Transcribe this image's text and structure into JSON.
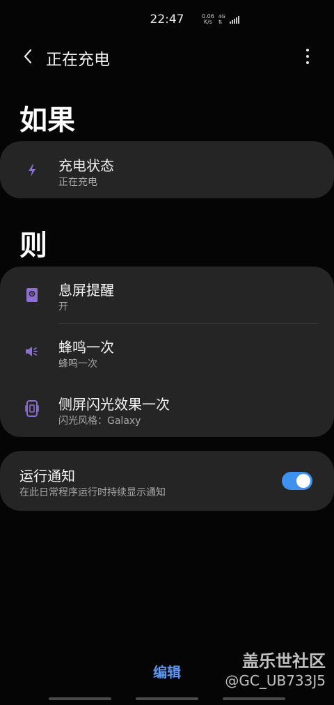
{
  "status_bar": {
    "time": "22:47",
    "net_speed_value": "0.06",
    "net_speed_unit": "K/s",
    "network_type": "4G"
  },
  "header": {
    "title": "正在充电"
  },
  "if_section": {
    "heading": "如果",
    "items": [
      {
        "title": "充电状态",
        "subtitle": "正在充电",
        "icon": "lightning-icon"
      }
    ]
  },
  "then_section": {
    "heading": "则",
    "items": [
      {
        "title": "息屏提醒",
        "subtitle": "开",
        "icon": "aod-icon"
      },
      {
        "title": "蜂鸣一次",
        "subtitle": "蜂鸣一次",
        "icon": "speaker-icon"
      },
      {
        "title": "侧屏闪光效果一次",
        "subtitle": "闪光风格：Galaxy",
        "icon": "edge-lighting-icon"
      }
    ]
  },
  "notification": {
    "title": "运行通知",
    "subtitle": "在此日常程序运行时持续显示通知",
    "enabled": true
  },
  "bottom": {
    "edit_label": "编辑"
  },
  "watermark": {
    "line1": "盖乐世社区",
    "line2": "@GC_UB733J5"
  },
  "colors": {
    "accent_icon": "#8c6fd1",
    "toggle_on": "#3e91ee",
    "edit_text": "#5f97f0",
    "card_bg": "#252525"
  }
}
